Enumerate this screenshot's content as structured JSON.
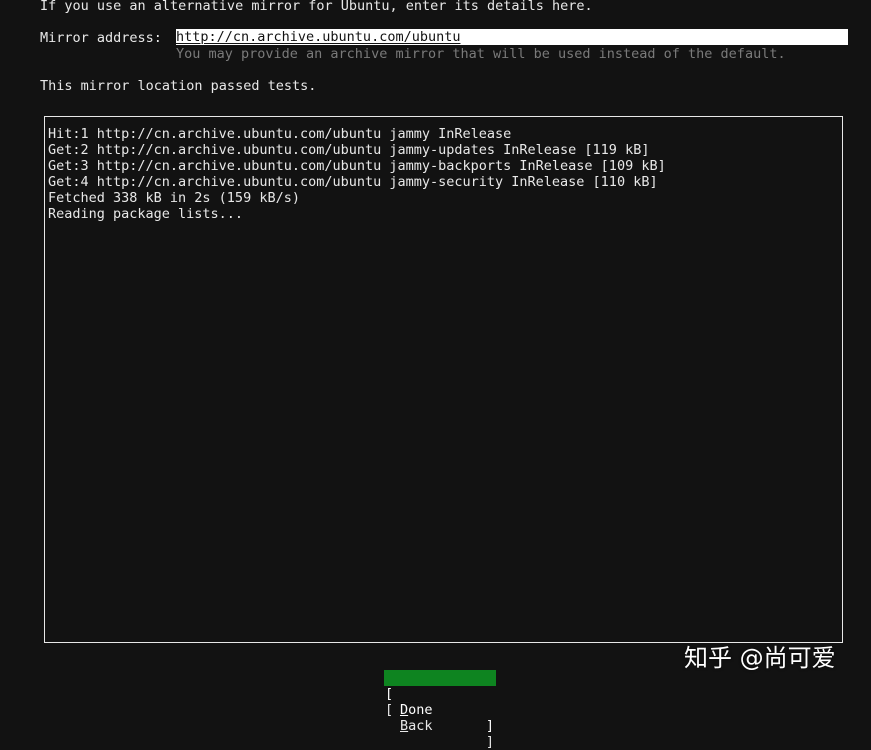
{
  "intro_text": "If you use an alternative mirror for Ubuntu, enter its details here.",
  "mirror": {
    "label": "Mirror address:",
    "value": "http://cn.archive.ubuntu.com/ubuntu",
    "hint": "You may provide an archive mirror that will be used instead of the default."
  },
  "status_text": "This mirror location passed tests.",
  "log_lines": [
    "Hit:1 http://cn.archive.ubuntu.com/ubuntu jammy InRelease",
    "Get:2 http://cn.archive.ubuntu.com/ubuntu jammy-updates InRelease [119 kB]",
    "Get:3 http://cn.archive.ubuntu.com/ubuntu jammy-backports InRelease [109 kB]",
    "Get:4 http://cn.archive.ubuntu.com/ubuntu jammy-security InRelease [110 kB]",
    "Fetched 338 kB in 2s (159 kB/s)",
    "Reading package lists..."
  ],
  "buttons": {
    "left_bracket": "[",
    "right_bracket": "]",
    "done": {
      "accel": "D",
      "rest": "one"
    },
    "back": {
      "accel": "B",
      "rest": "ack"
    }
  },
  "watermark": "知乎 @尚可爱",
  "colors": {
    "background": "#121212",
    "text": "#e8e8e8",
    "hint": "#7a7a7a",
    "done_button": "#0e8420"
  }
}
